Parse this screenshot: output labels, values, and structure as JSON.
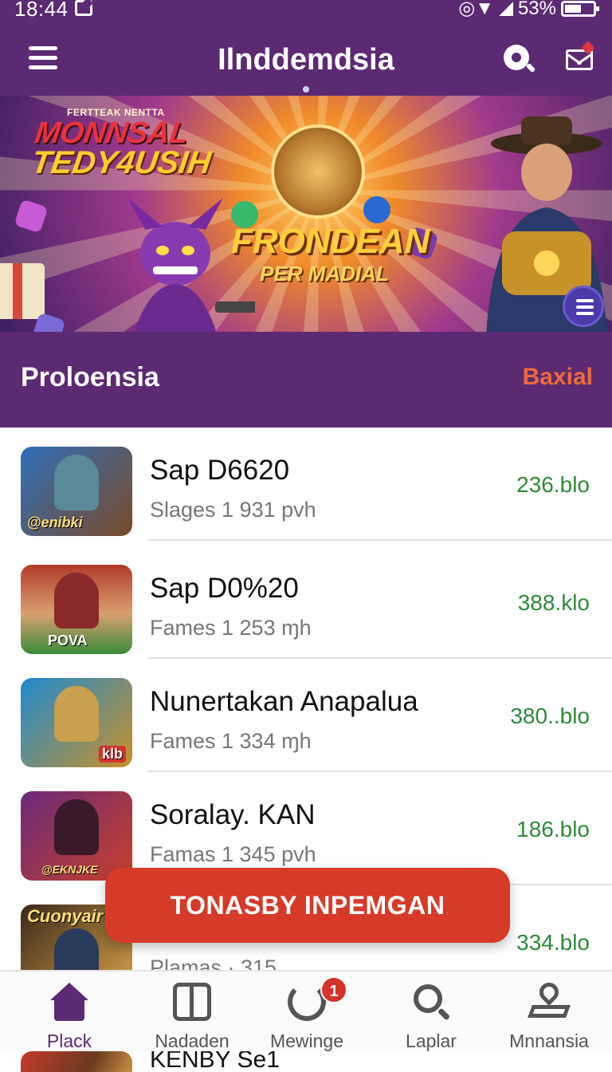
{
  "status_bar": {
    "time": "18:44",
    "battery": "53%"
  },
  "app": {
    "title": "Ilnddemdsia"
  },
  "banner": {
    "small_text": "FERTTEAK NENTTA",
    "logo_line1": "MONNSAL",
    "logo_line2": "TEDY4USIH",
    "headline": "FRONDEAN",
    "subheadline": "PER MADIAL"
  },
  "section": {
    "title": "Proloensia",
    "link": "Baxial"
  },
  "games": [
    {
      "name": "Sap D6620",
      "meta": "Slages  1  931  pvh",
      "size": "236.blo",
      "thumb_label": "@enibki",
      "colors": [
        "#2f6fb8",
        "#7a4a2a"
      ]
    },
    {
      "name": "Sap D0%20",
      "meta": "Fames  1  253  ɱh",
      "size": "388.klo",
      "thumb_label": "POVA",
      "colors": [
        "#b23a2a",
        "#3a8a3a"
      ]
    },
    {
      "name": "Nunertakan Anapalua",
      "meta": "Fames  1  334  ɱh",
      "size": "380..blo",
      "thumb_label": "klb",
      "colors": [
        "#1f8ad0",
        "#c8902a"
      ]
    },
    {
      "name": "Soralay. KAN",
      "meta": "Famas  1  345  pvh",
      "size": "186.blo",
      "thumb_label": "@EKNJKE",
      "colors": [
        "#6a2a7a",
        "#c8402a"
      ]
    },
    {
      "name": "",
      "meta": "Plamas  ·  315",
      "size": "334.blo",
      "thumb_label": "Cuonyair",
      "colors": [
        "#3a2a1a",
        "#d9a04a"
      ]
    }
  ],
  "peek_row": {
    "name": "KENBY Se1"
  },
  "cta": {
    "label": "TONASBY INPEMGAN"
  },
  "nav": {
    "items": [
      {
        "label": "Plack",
        "icon": "home-icon"
      },
      {
        "label": "Nadaden",
        "icon": "book-icon"
      },
      {
        "label": "Mewinge",
        "icon": "refresh-icon",
        "badge": "1"
      },
      {
        "label": "Laplar",
        "icon": "search-icon"
      },
      {
        "label": "Mnnansia",
        "icon": "map-icon"
      }
    ]
  },
  "colors": {
    "primary": "#5b2a72",
    "accent": "#ee6a3c",
    "cta": "#d63a28",
    "size_text": "#2f8a3a"
  }
}
